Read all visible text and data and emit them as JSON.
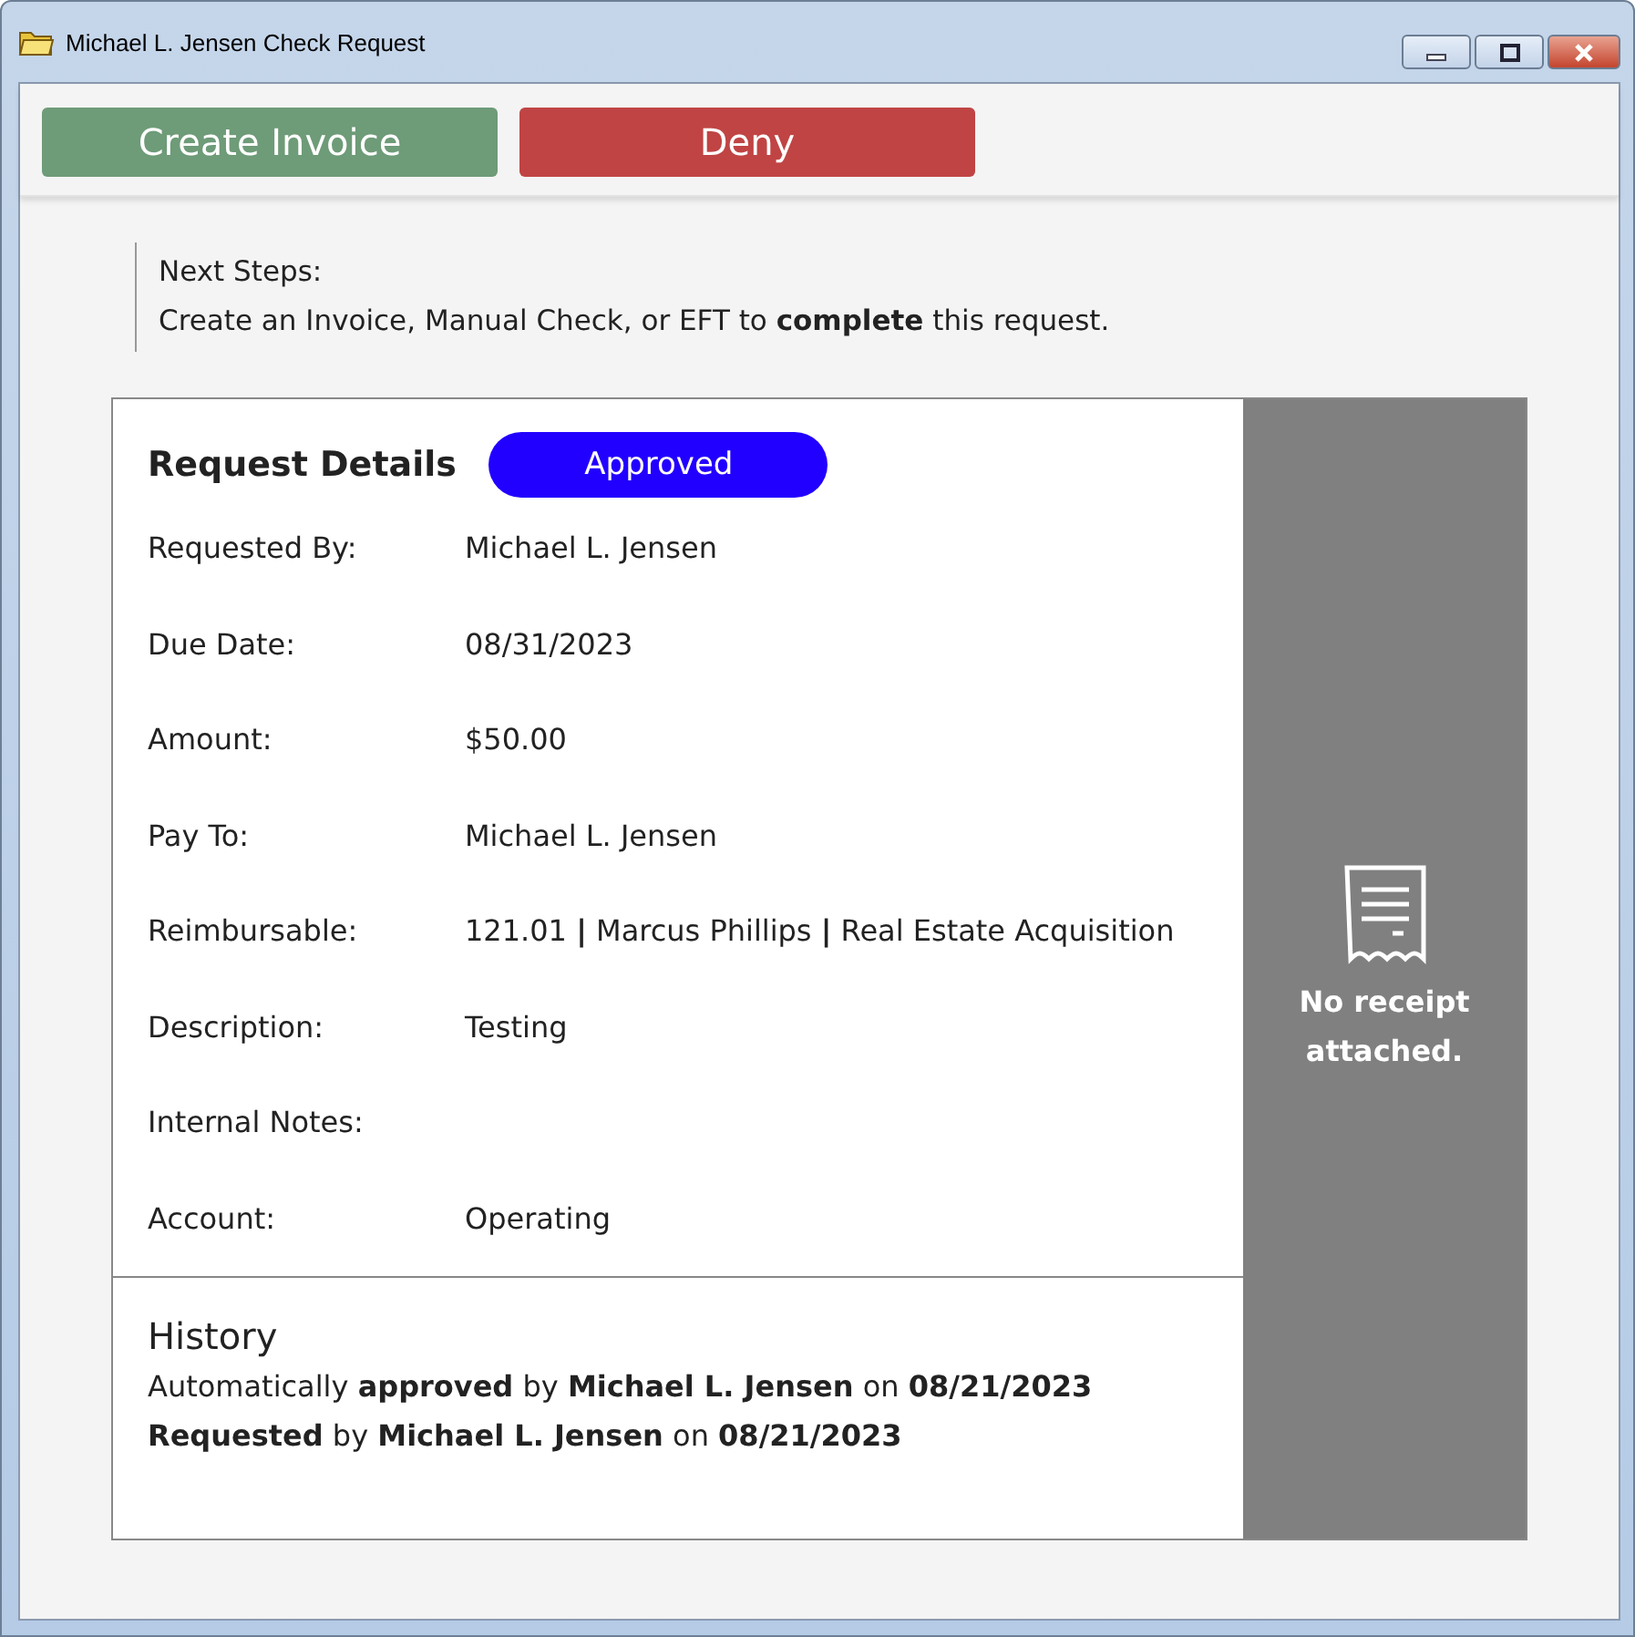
{
  "window": {
    "title": "Michael L. Jensen Check Request"
  },
  "toolbar": {
    "buttons": [
      {
        "label": "Create Invoice",
        "kind": "primary"
      },
      {
        "label": "Deny",
        "kind": "danger"
      }
    ]
  },
  "next_steps": {
    "heading": "Next Steps:",
    "text": "Create an Invoice, Manual Check, or EFT to **complete** this request."
  },
  "request_details": {
    "title": "Request Details",
    "status": {
      "label": "Approved",
      "kind": "approved"
    },
    "fields": [
      {
        "label": "Requested By:",
        "value": "Michael L. Jensen"
      },
      {
        "label": "Due Date:",
        "value": "08/31/2023"
      },
      {
        "label": "Amount:",
        "value": "$50.00"
      },
      {
        "label": "Pay To:",
        "value": "Michael L. Jensen"
      },
      {
        "label": "Reimbursable:",
        "value": "121.01 **|** Marcus Phillips **|** Real Estate Acquisition"
      },
      {
        "label": "Description:",
        "value": "Testing"
      },
      {
        "label": "Internal Notes:"
      },
      {
        "label": "Account:",
        "value": "Operating"
      }
    ]
  },
  "history": {
    "title": "History",
    "entries": [
      "Automatically **approved** by **Michael L. Jensen** on **08/21/2023**",
      "**Requested** by **Michael L. Jensen** on **08/21/2023**"
    ]
  },
  "receipt": {
    "message": "No receipt attached."
  }
}
